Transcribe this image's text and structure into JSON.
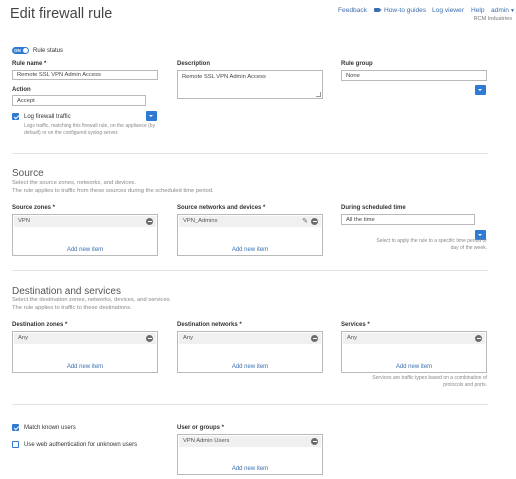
{
  "header": {
    "title": "Edit firewall rule",
    "nav": {
      "feedback": "Feedback",
      "howto": "How-to guides",
      "logviewer": "Log viewer",
      "help": "Help",
      "user": "admin"
    },
    "org": "RCM Industries"
  },
  "rule_status": {
    "toggle_text": "ON",
    "label": "Rule status"
  },
  "rule_name": {
    "label": "Rule name *",
    "value": "Remote SSL VPN Admin Access"
  },
  "description": {
    "label": "Description",
    "value": "Remote SSL VPN Admin Access"
  },
  "rule_group": {
    "label": "Rule group",
    "value": "None"
  },
  "action": {
    "label": "Action",
    "value": "Accept"
  },
  "log_traffic": {
    "label": "Log firewall traffic",
    "help_line1": "Logs traffic, matching this firewall rule, on the appliance (by",
    "help_line2": "default) or on the configured syslog server."
  },
  "source": {
    "title": "Source",
    "desc1": "Select the source zones, networks, and devices.",
    "desc2": "The rule applies to traffic from these sources during the scheduled time period.",
    "zones": {
      "label": "Source zones *",
      "item": "VPN",
      "add": "Add new item"
    },
    "networks": {
      "label": "Source networks and devices *",
      "item": "VPN_Admins",
      "add": "Add new item"
    },
    "schedule": {
      "label": "During scheduled time",
      "value": "All the time",
      "help_line1": "Select to apply the rule to a specific time period or",
      "help_line2": "day of the week."
    }
  },
  "destination": {
    "title": "Destination and services",
    "desc1": "Select the destination zones, networks, devices, and services.",
    "desc2": "The rule applies to traffic to these destinations.",
    "zones": {
      "label": "Destination zones *",
      "item": "Any",
      "add": "Add new item"
    },
    "networks": {
      "label": "Destination networks *",
      "item": "Any",
      "add": "Add new item"
    },
    "services": {
      "label": "Services *",
      "item": "Any",
      "add": "Add new item",
      "help_line1": "Services are traffic types based on a combination of",
      "help_line2": "protocols and ports."
    }
  },
  "users": {
    "match_known": "Match known users",
    "web_auth": "Use web authentication for unknown users",
    "groups": {
      "label": "User or groups *",
      "item": "VPN Admin Users",
      "add": "Add new item"
    }
  }
}
